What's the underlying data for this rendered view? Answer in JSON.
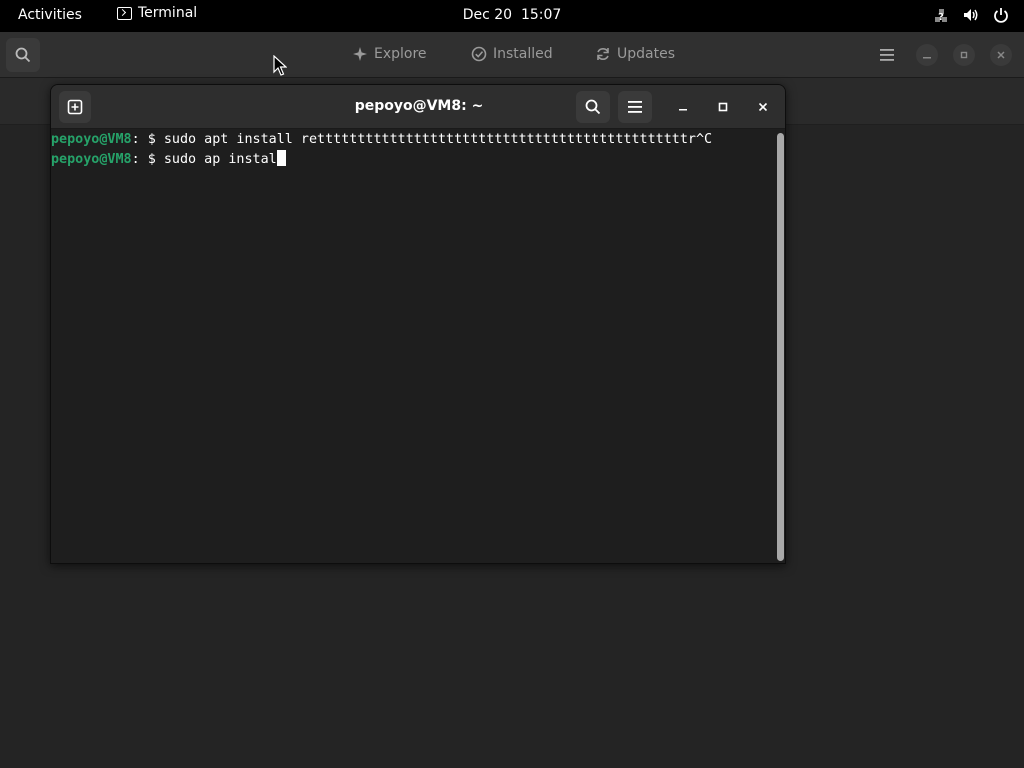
{
  "topbar": {
    "activities_label": "Activities",
    "app_name": "Terminal",
    "clock": "Dec 20  15:07"
  },
  "software": {
    "tabs": [
      {
        "label": "Explore",
        "icon": "explore-icon"
      },
      {
        "label": "Installed",
        "icon": "check-icon"
      },
      {
        "label": "Updates",
        "icon": "refresh-icon"
      }
    ]
  },
  "terminal": {
    "title": "pepoyo@VM8: ~",
    "lines": [
      {
        "prompt": "pepoyo@VM8",
        "sep": ": $ ",
        "command": "sudo apt install rettttttttttttttttttttttttttttttttttttttttttttttr^C"
      },
      {
        "prompt": "pepoyo@VM8",
        "sep": ": $ ",
        "command": "sudo ap instal"
      }
    ]
  },
  "colors": {
    "prompt": "#26a269",
    "topbar": "#000000",
    "terminal_bg": "#1e1e1e",
    "header_bg": "#2e2e2e"
  }
}
